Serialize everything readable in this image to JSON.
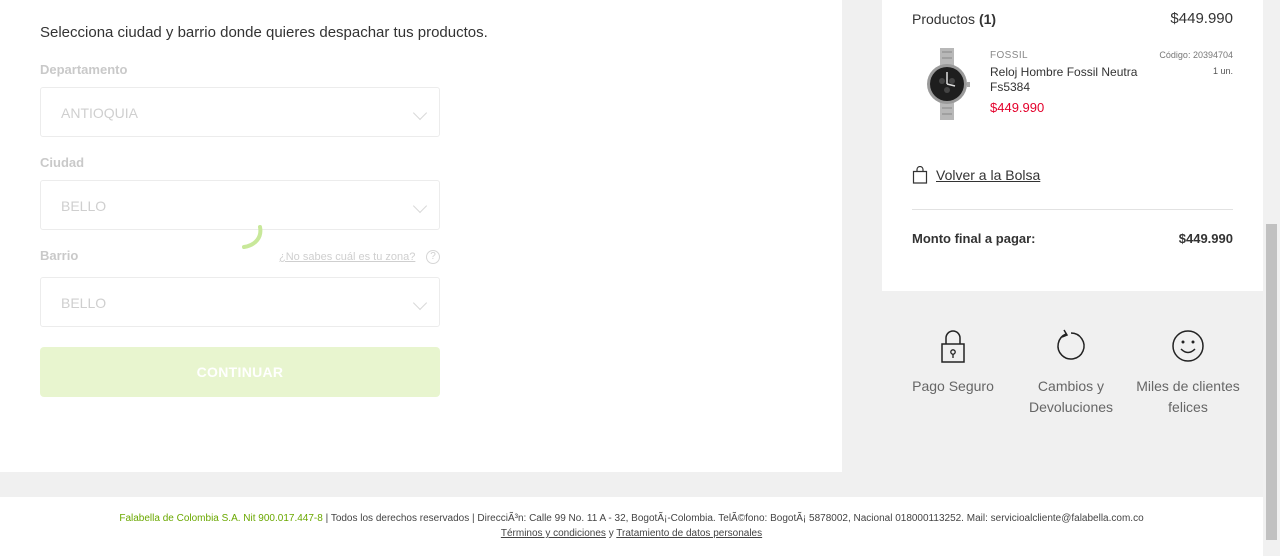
{
  "form": {
    "intro": "Selecciona ciudad y barrio donde quieres despachar tus productos.",
    "department_label": "Departamento",
    "department_value": "ANTIOQUIA",
    "city_label": "Ciudad",
    "city_value": "BELLO",
    "neighborhood_label": "Barrio",
    "neighborhood_value": "BELLO",
    "zone_help": "¿No sabes cuál es tu zona?",
    "help_icon_text": "?",
    "continue_label": "CONTINUAR"
  },
  "cart": {
    "products_label": "Productos",
    "products_count": "(1)",
    "products_total": "$449.990",
    "item": {
      "brand": "FOSSIL",
      "name": "Reloj Hombre Fossil Neutra Fs5384",
      "price": "$449.990",
      "code": "Código: 20394704",
      "quantity": "1 un."
    },
    "back_to_bag": "Volver a la Bolsa",
    "final_label": "Monto final a pagar:",
    "final_amount": "$449.990"
  },
  "trust": {
    "secure": "Pago Seguro",
    "returns": "Cambios y Devoluciones",
    "happy": "Miles de clientes felices"
  },
  "footer": {
    "company": "Falabella de Colombia S.A. Nit 900.017.447-8",
    "sep": "|",
    "rights": "Todos los derechos reservados",
    "address": "DirecciÃ³n: Calle 99 No. 11 A - 32, BogotÃ¡-Colombia. TelÃ©fono: BogotÃ¡ 5878002, Nacional 018000113252. Mail: servicioalcliente@falabella.com.co",
    "terms": "Términos y condiciones",
    "and": "y",
    "privacy": "Tratamiento de datos personales"
  },
  "colors": {
    "accent_green": "#6aa800",
    "price_red": "#e4002b",
    "disabled_button": "#e8f5cf"
  }
}
